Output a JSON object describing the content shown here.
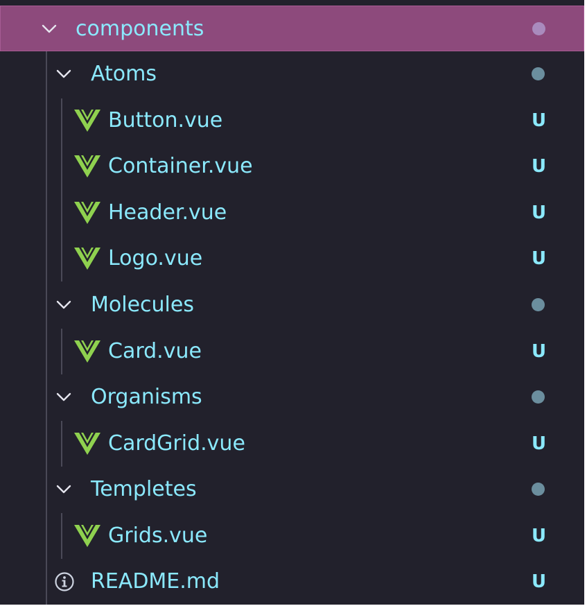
{
  "colors": {
    "panel_bg": "#22212c",
    "selected_bg": "#8d4a7c",
    "folder_text": "#8be9fd",
    "selected_text": "#8be9fd",
    "file_text": "#8be9fd",
    "untracked_badge": "#8be9fd",
    "folder_dot": "#6b8e9e",
    "selected_dot": "#a98bbd",
    "vue_icon": "#8fd14f",
    "info_icon": "#cdd3e0",
    "guide_line": "#4a4957"
  },
  "tree": {
    "root": {
      "label": "components",
      "icon": "chevron-down-icon",
      "expanded": true,
      "selected": true
    },
    "folders": [
      {
        "label": "Atoms",
        "icon": "chevron-down-icon",
        "expanded": true,
        "files": [
          {
            "label": "Button.vue",
            "icon": "vue-icon",
            "status": "U"
          },
          {
            "label": "Container.vue",
            "icon": "vue-icon",
            "status": "U"
          },
          {
            "label": "Header.vue",
            "icon": "vue-icon",
            "status": "U"
          },
          {
            "label": "Logo.vue",
            "icon": "vue-icon",
            "status": "U"
          }
        ]
      },
      {
        "label": "Molecules",
        "icon": "chevron-down-icon",
        "expanded": true,
        "files": [
          {
            "label": "Card.vue",
            "icon": "vue-icon",
            "status": "U"
          }
        ]
      },
      {
        "label": "Organisms",
        "icon": "chevron-down-icon",
        "expanded": true,
        "files": [
          {
            "label": "CardGrid.vue",
            "icon": "vue-icon",
            "status": "U"
          }
        ]
      },
      {
        "label": "Templetes",
        "icon": "chevron-down-icon",
        "expanded": true,
        "files": [
          {
            "label": "Grids.vue",
            "icon": "vue-icon",
            "status": "U"
          }
        ]
      }
    ],
    "root_files": [
      {
        "label": "README.md",
        "icon": "info-icon",
        "status": "U"
      }
    ]
  }
}
